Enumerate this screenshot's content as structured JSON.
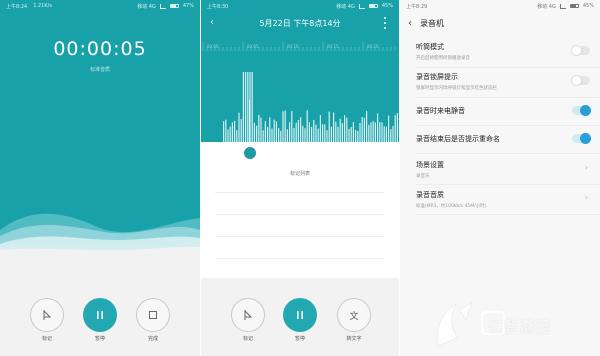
{
  "status_bars": [
    {
      "time": "上午8:24",
      "network": "1.21K/s",
      "carrier": "移动 4G",
      "battery": "47%"
    },
    {
      "time": "上午8:30",
      "network": "",
      "carrier": "移动 4G",
      "battery": "45%"
    },
    {
      "time": "上午8:29",
      "network": "",
      "carrier": "移动 4G",
      "battery": "45%"
    }
  ],
  "recorder": {
    "timer": "00:00:05",
    "timer_sub": "标准音质",
    "controls": [
      {
        "label": "标记",
        "icon": "flag-icon"
      },
      {
        "label": "暂停",
        "icon": "pause-icon"
      },
      {
        "label": "完成",
        "icon": "stop-icon"
      }
    ]
  },
  "playback": {
    "title": "5月22日 下午8点14分",
    "marker_label": "标记列表",
    "ruler_labels": [
      "00:00",
      "00:05",
      "00:10",
      "00:15",
      "00:20"
    ],
    "controls": [
      {
        "label": "标记",
        "icon": "flag-icon"
      },
      {
        "label": "暂停",
        "icon": "pause-icon"
      },
      {
        "label": "转文字",
        "icon": "text-icon"
      }
    ]
  },
  "settings": {
    "title": "录音机",
    "items": [
      {
        "title": "听筒模式",
        "desc": "开启后将使用听筒播放录音",
        "type": "toggle",
        "on": false
      },
      {
        "title": "录音锁屏提示",
        "desc": "锁屏时显示闪烁呼吸灯和显示红色状态栏",
        "type": "toggle",
        "on": false
      },
      {
        "title": "录音时来电静音",
        "desc": "",
        "type": "toggle",
        "on": true
      },
      {
        "title": "录音结束后是否提示重命名",
        "desc": "",
        "type": "toggle",
        "on": true
      },
      {
        "title": "场景设置",
        "desc": "录音乐",
        "type": "chevron"
      },
      {
        "title": "录音音质",
        "desc": "标准(MP3，约100kb/s 45M/小时)",
        "type": "chevron"
      }
    ]
  },
  "watermark": "亿智蘑菇",
  "colors": {
    "teal": "#19a1aa",
    "accent_blue": "#2a9fd6"
  }
}
